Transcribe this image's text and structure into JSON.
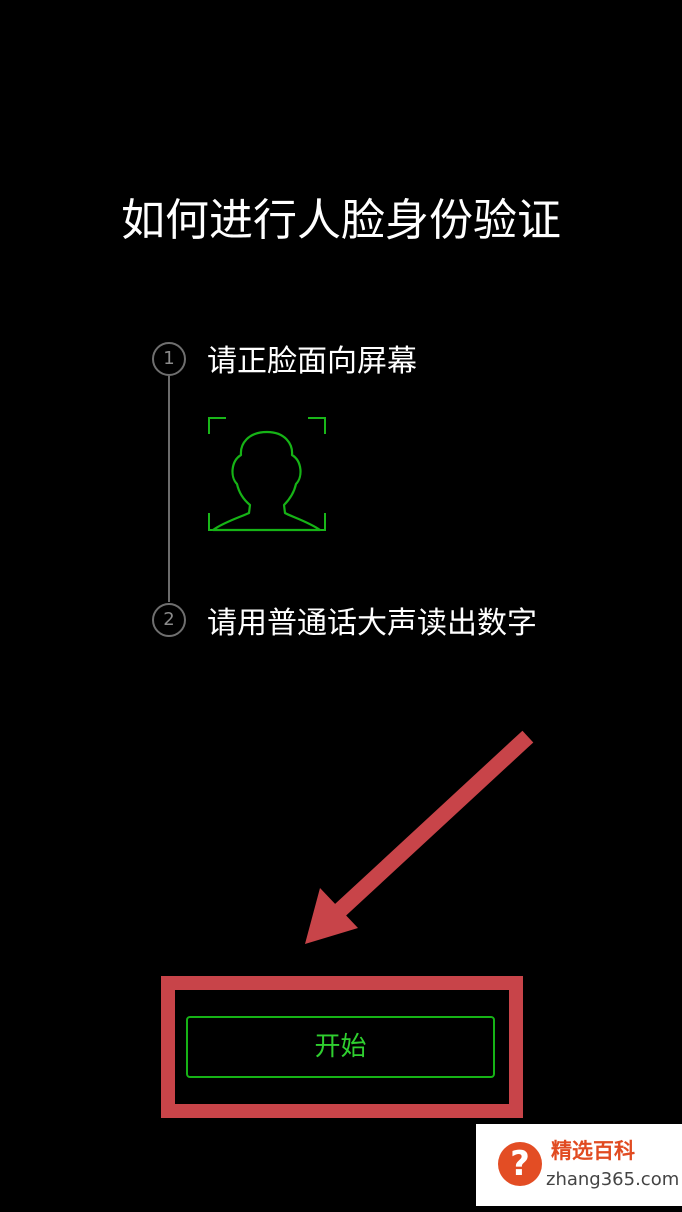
{
  "page": {
    "title": "如何进行人脸身份验证"
  },
  "steps": [
    {
      "number": "1",
      "text": "请正脸面向屏幕"
    },
    {
      "number": "2",
      "text": "请用普通话大声读出数字"
    }
  ],
  "icons": {
    "face_frame": "face-outline-icon",
    "arrow": "arrow-pointing-to-button"
  },
  "actions": {
    "start_label": "开始"
  },
  "watermark": {
    "icon": "?",
    "title": "精选百科",
    "domain": "zhang365.com"
  },
  "colors": {
    "background": "#000000",
    "accent_green": "#16b316",
    "highlight_red": "#c84449",
    "watermark_orange": "#e14b21"
  }
}
